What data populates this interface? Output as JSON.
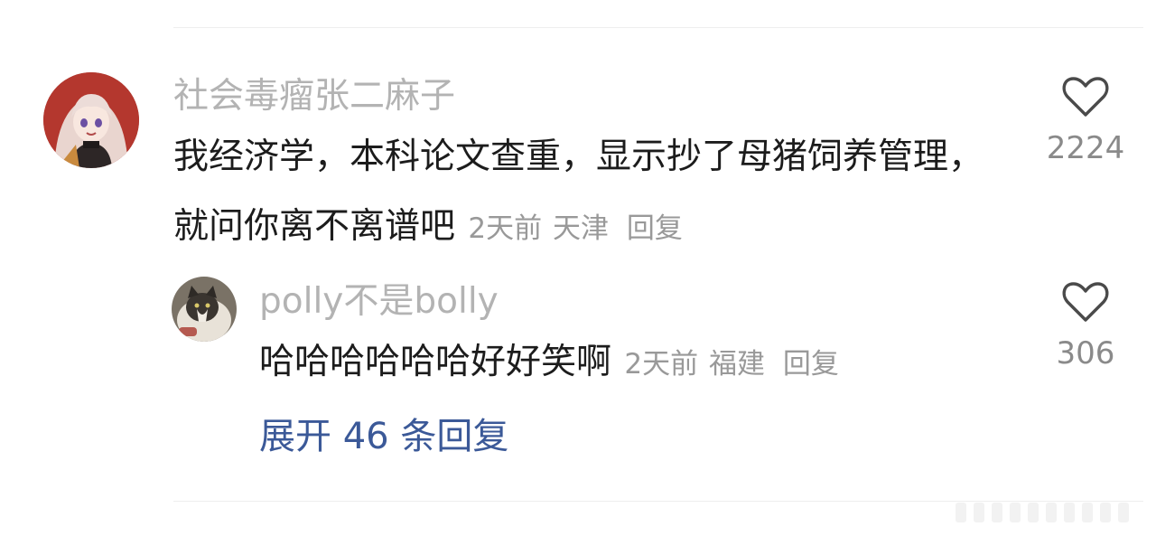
{
  "comment": {
    "username": "社会毒瘤张二麻子",
    "content": "我经济学，本科论文查重，显示抄了母猪饲养管理，就问你离不离谱吧",
    "time": "2天前",
    "location": "天津",
    "reply_label": "回复",
    "likes": "2224"
  },
  "reply": {
    "username": "polly不是bolly",
    "content": "哈哈哈哈哈哈好好笑啊",
    "time": "2天前",
    "location": "福建",
    "reply_label": "回复",
    "likes": "306"
  },
  "expand_label": "展开 46 条回复",
  "icons": {
    "like": "heart-outline-icon",
    "main_avatar": "anime-girl-avatar",
    "reply_avatar": "cat-avatar"
  },
  "colors": {
    "username": "#b3b3b3",
    "content": "#1c1c1c",
    "meta": "#999999",
    "link": "#3b5998"
  }
}
